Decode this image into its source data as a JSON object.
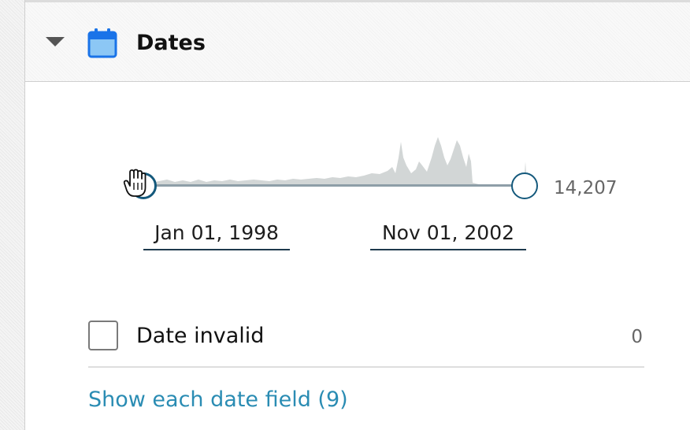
{
  "section": {
    "title": "Dates",
    "caret_icon": "caret-down-icon",
    "calendar_icon": "calendar-icon",
    "accent_color": "#2a8cb3",
    "icon_color": "#1a73e8"
  },
  "range_slider": {
    "start_date": "Jan 01, 1998",
    "end_date": "Nov 01, 2002",
    "count": "14,207",
    "handle_color": "#14597c",
    "selected_range_fraction": [
      0.0,
      1.0
    ]
  },
  "invalid_filter": {
    "label": "Date invalid",
    "count": "0",
    "checked": false
  },
  "show_more_link": "Show each date field (9)"
}
